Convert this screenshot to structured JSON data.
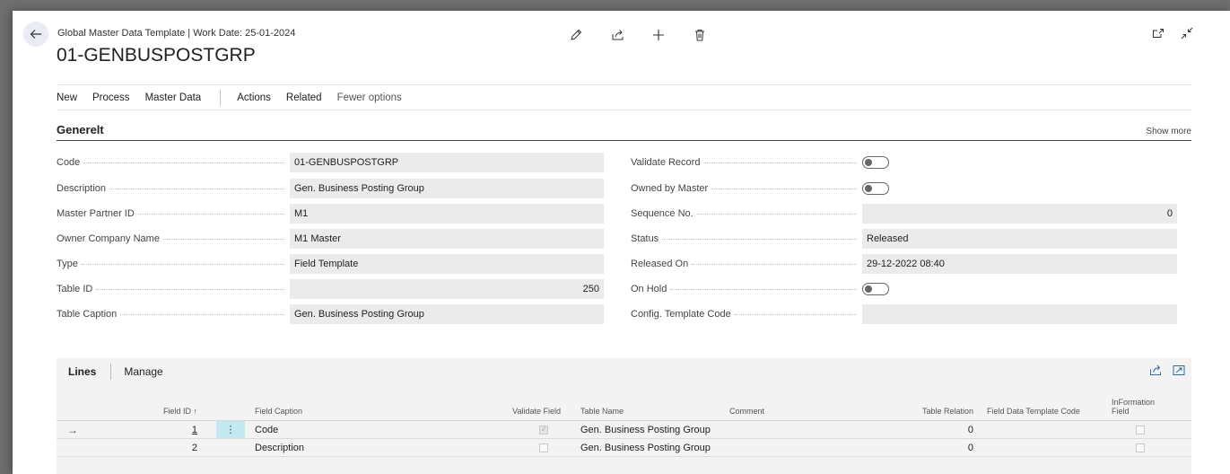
{
  "header": {
    "subtitle": "Global Master Data Template | Work Date: 25-01-2024",
    "title": "01-GENBUSPOSTGRP"
  },
  "action_bar": {
    "items": [
      "New",
      "Process",
      "Master Data",
      "Actions",
      "Related"
    ],
    "fewer_options": "Fewer options"
  },
  "section": {
    "title": "Generelt",
    "show_more": "Show more"
  },
  "fields_left": [
    {
      "label": "Code",
      "value": "01-GENBUSPOSTGRP"
    },
    {
      "label": "Description",
      "value": "Gen. Business Posting Group"
    },
    {
      "label": "Master Partner ID",
      "value": "M1"
    },
    {
      "label": "Owner Company Name",
      "value": "M1 Master"
    },
    {
      "label": "Type",
      "value": "Field Template"
    },
    {
      "label": "Table ID",
      "value": "250"
    },
    {
      "label": "Table Caption",
      "value": "Gen. Business Posting Group"
    }
  ],
  "fields_right": [
    {
      "label": "Validate Record",
      "value": "",
      "toggle": false
    },
    {
      "label": "Owned by Master",
      "value": "",
      "toggle": false
    },
    {
      "label": "Sequence No.",
      "value": "0"
    },
    {
      "label": "Status",
      "value": "Released"
    },
    {
      "label": "Released On",
      "value": "29-12-2022 08:40"
    },
    {
      "label": "On Hold",
      "value": "",
      "toggle": false
    },
    {
      "label": "Config. Template Code",
      "value": ""
    }
  ],
  "lines": {
    "title": "Lines",
    "manage": "Manage",
    "columns": {
      "field_id": "Field ID ↑",
      "field_caption": "Field Caption",
      "validate_field": "Validate Field",
      "table_name": "Table Name",
      "comment": "Comment",
      "table_relation": "Table Relation",
      "field_data_template_code": "Field Data Template Code",
      "information_field": "InFormation Field"
    },
    "rows": [
      {
        "field_id": "1",
        "field_caption": "Code",
        "validate_field": true,
        "table_name": "Gen. Business Posting Group",
        "comment": "",
        "table_relation": "0",
        "field_data_template_code": "",
        "information_field": false
      },
      {
        "field_id": "2",
        "field_caption": "Description",
        "validate_field": false,
        "table_name": "Gen. Business Posting Group",
        "comment": "",
        "table_relation": "0",
        "field_data_template_code": "",
        "information_field": false
      }
    ]
  },
  "icons": {
    "back": "back-arrow-icon",
    "edit": "pencil-icon",
    "share": "share-icon",
    "new": "plus-icon",
    "delete": "trash-icon",
    "open_new_window": "open-in-new-window-icon",
    "collapse": "collapse-icon"
  }
}
